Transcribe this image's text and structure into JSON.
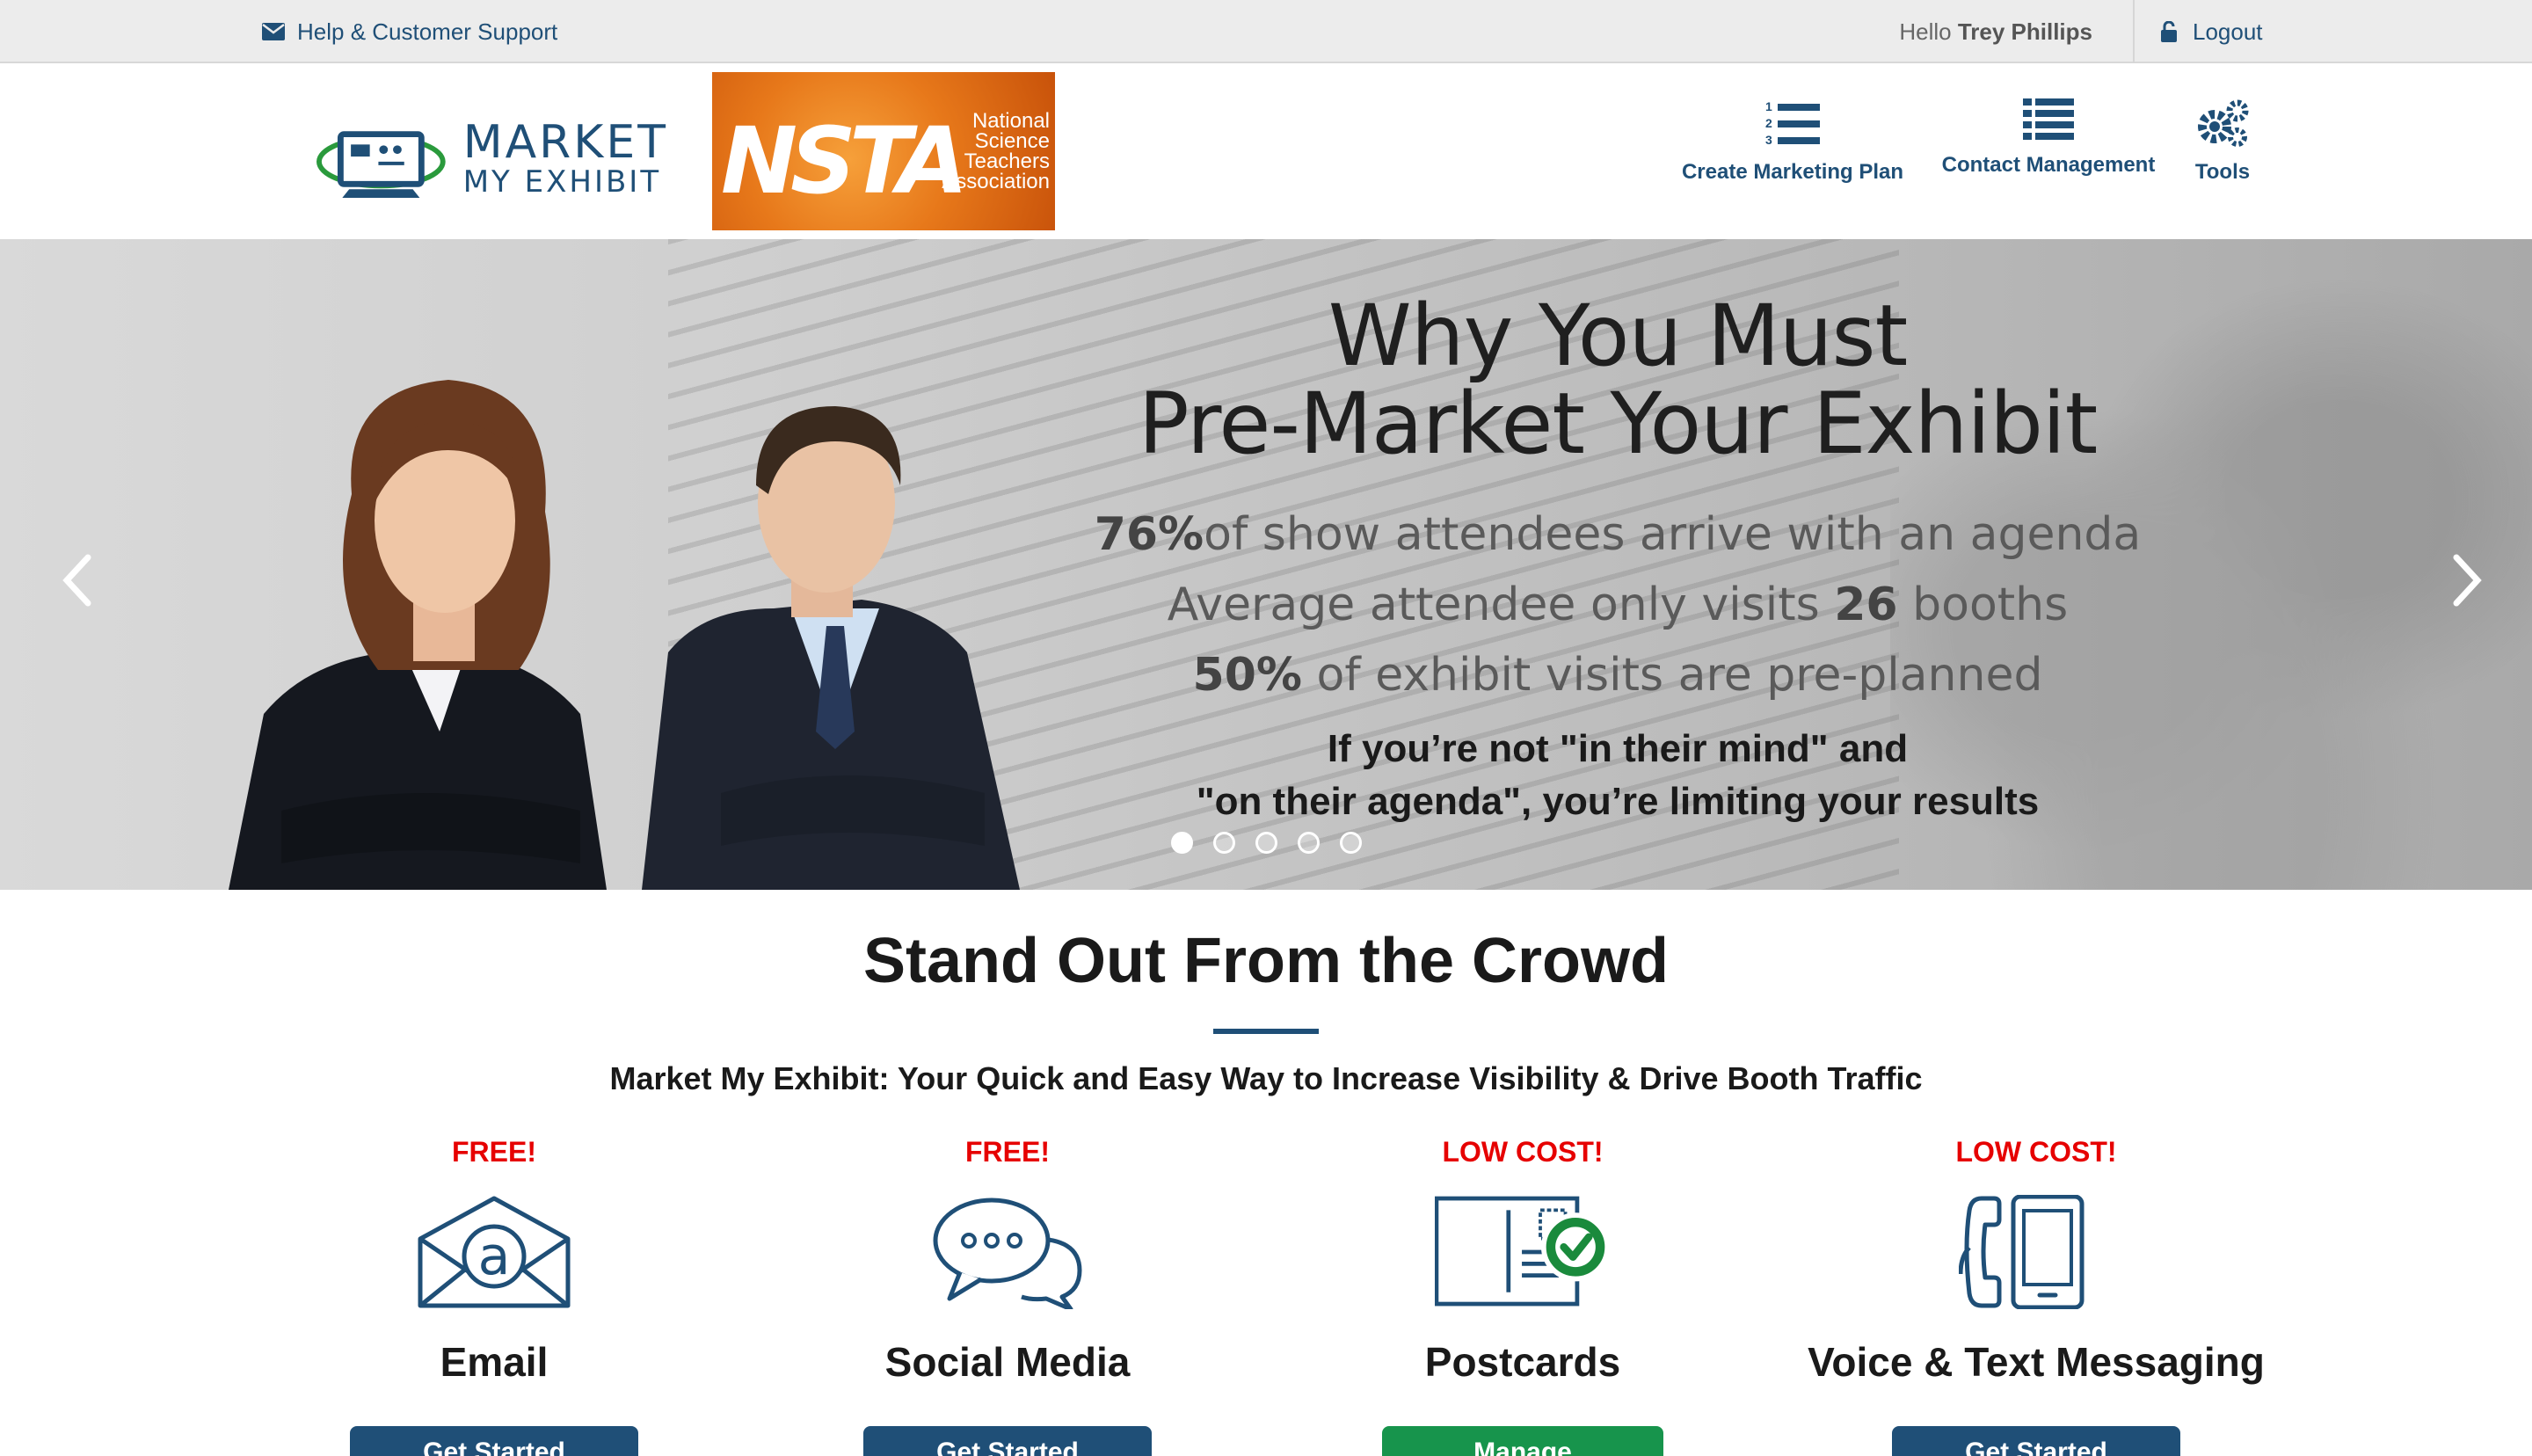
{
  "topbar": {
    "help_label": "Help & Customer Support",
    "hello_prefix": "Hello",
    "user_name": "Trey Phillips",
    "logout_label": "Logout"
  },
  "header": {
    "logo_line1": "MARKET",
    "logo_line2": "MY EXHIBIT",
    "partner_mark": "NSTA",
    "partner_words": [
      "National",
      "Science",
      "Teachers",
      "Association"
    ],
    "nav": [
      {
        "label": "Create Marketing Plan",
        "icon": "numbered-list-icon"
      },
      {
        "label": "Contact Management",
        "icon": "list-icon"
      },
      {
        "label": "Tools",
        "icon": "gears-icon"
      }
    ]
  },
  "hero": {
    "title_line1": "Why You Must",
    "title_line2": "Pre-Market Your Exhibit",
    "stat1_value": "76%",
    "stat1_text": "of show attendees arrive with an agenda",
    "stat2_text": "Average attendee only visits",
    "stat2_value": "26",
    "stat2_suffix": "booths",
    "stat3_value": "50%",
    "stat3_text": "of exhibit visits are pre-planned",
    "cta_line1": "If you’re not \"in their mind\" and",
    "cta_line2": "\"on their agenda\", you’re limiting your results",
    "slide_count": 5,
    "active_slide": 1
  },
  "content": {
    "title": "Stand Out From the Crowd",
    "subtitle": "Market My Exhibit: Your Quick and Easy Way to Increase Visibility & Drive Booth Traffic",
    "features": [
      {
        "price": "FREE!",
        "name": "Email",
        "button": "Get Started",
        "icon": "email-icon"
      },
      {
        "price": "FREE!",
        "name": "Social Media",
        "button": "Get Started",
        "icon": "chat-bubbles-icon"
      },
      {
        "price": "LOW COST!",
        "name": "Postcards",
        "button": "Manage",
        "icon": "postcard-check-icon"
      },
      {
        "price": "LOW COST!",
        "name": "Voice & Text Messaging",
        "button": "Get Started",
        "icon": "phone-icon"
      }
    ]
  },
  "colors": {
    "brand_blue": "#1f4f77",
    "price_red": "#e60000",
    "manage_green": "#17944c",
    "topbar_bg": "#ececec"
  }
}
